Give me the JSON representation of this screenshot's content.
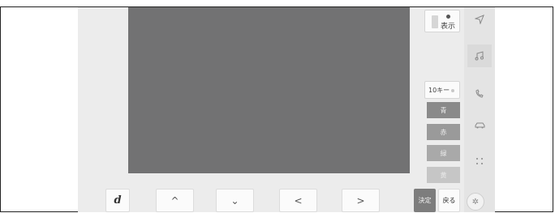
{
  "panel": {
    "display_label": "表示",
    "key_label": "10キー",
    "colors": [
      {
        "label": "青",
        "bg": "#8a8a8a"
      },
      {
        "label": "赤",
        "bg": "#9a9a9a"
      },
      {
        "label": "緑",
        "bg": "#a9a9a9"
      },
      {
        "label": "黄",
        "bg": "#c6c6c6"
      }
    ]
  },
  "sidebar": {
    "icons": [
      "navigation-icon",
      "music-icon",
      "phone-icon",
      "car-icon",
      "apps-icon"
    ]
  },
  "bottom": {
    "d_label": "d",
    "up_label": "^",
    "down_label": "⌄",
    "left_label": "<",
    "right_label": ">",
    "enter_label": "決定",
    "back_label": "戻る"
  }
}
